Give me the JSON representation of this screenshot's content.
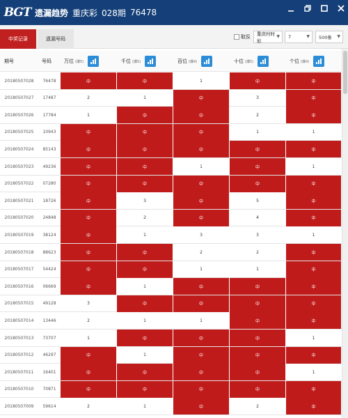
{
  "titlebar": {
    "logo": "BGT",
    "app_name": "遗漏趋势",
    "lottery": "重庆彩",
    "issue": "028期",
    "draw": "76478"
  },
  "tabs": [
    {
      "label": "中奖记录",
      "active": true
    },
    {
      "label": "遗漏号码",
      "active": false
    }
  ],
  "toolbar": {
    "reverse_label": "取反",
    "select_1": "重庆时时彩",
    "select_2": "7",
    "select_3": "500条"
  },
  "columns": {
    "period": "期号",
    "number": "号码",
    "positions": [
      {
        "label": "万位",
        "sub": "(爆5)"
      },
      {
        "label": "千位",
        "sub": "(爆5)"
      },
      {
        "label": "百位",
        "sub": "(爆4)"
      },
      {
        "label": "十位",
        "sub": "(爆5)"
      },
      {
        "label": "个位",
        "sub": "(爆4)"
      }
    ]
  },
  "rows": [
    {
      "period": "20180507028",
      "number": "76478",
      "cells": [
        "中",
        "中",
        "1",
        "中",
        "中"
      ]
    },
    {
      "period": "20180507027",
      "number": "17487",
      "cells": [
        "2",
        "1",
        "中",
        "3",
        "中"
      ]
    },
    {
      "period": "20180507026",
      "number": "17784",
      "cells": [
        "1",
        "中",
        "中",
        "2",
        "中"
      ]
    },
    {
      "period": "20180507025",
      "number": "10943",
      "cells": [
        "中",
        "中",
        "中",
        "1",
        "1"
      ]
    },
    {
      "period": "20180507024",
      "number": "85143",
      "cells": [
        "中",
        "中",
        "中",
        "中",
        "中"
      ]
    },
    {
      "period": "20180507023",
      "number": "49236",
      "cells": [
        "中",
        "中",
        "1",
        "中",
        "1"
      ]
    },
    {
      "period": "20180507022",
      "number": "07280",
      "cells": [
        "中",
        "中",
        "中",
        "中",
        "中"
      ]
    },
    {
      "period": "20180507021",
      "number": "18726",
      "cells": [
        "中",
        "3",
        "中",
        "5",
        "中"
      ]
    },
    {
      "period": "20180507020",
      "number": "24848",
      "cells": [
        "中",
        "2",
        "中",
        "4",
        "中"
      ]
    },
    {
      "period": "20180507019",
      "number": "38124",
      "cells": [
        "中",
        "1",
        "3",
        "3",
        "1"
      ]
    },
    {
      "period": "20180507018",
      "number": "88623",
      "cells": [
        "中",
        "中",
        "2",
        "2",
        "中"
      ]
    },
    {
      "period": "20180507017",
      "number": "54424",
      "cells": [
        "中",
        "中",
        "1",
        "1",
        "中"
      ]
    },
    {
      "period": "20180507016",
      "number": "06669",
      "cells": [
        "中",
        "1",
        "中",
        "中",
        "中"
      ]
    },
    {
      "period": "20180507015",
      "number": "49128",
      "cells": [
        "3",
        "中",
        "中",
        "中",
        "中"
      ]
    },
    {
      "period": "20180507014",
      "number": "13446",
      "cells": [
        "2",
        "1",
        "1",
        "中",
        "中"
      ]
    },
    {
      "period": "20180507013",
      "number": "73707",
      "cells": [
        "1",
        "中",
        "中",
        "中",
        "1"
      ]
    },
    {
      "period": "20180507012",
      "number": "46297",
      "cells": [
        "中",
        "1",
        "中",
        "中",
        "中"
      ]
    },
    {
      "period": "20180507011",
      "number": "16401",
      "cells": [
        "中",
        "中",
        "中",
        "中",
        "1"
      ]
    },
    {
      "period": "20180507010",
      "number": "70871",
      "cells": [
        "中",
        "中",
        "中",
        "中",
        "中"
      ]
    },
    {
      "period": "20180507009",
      "number": "59614",
      "cells": [
        "2",
        "1",
        "中",
        "2",
        "中"
      ]
    }
  ],
  "colors": {
    "titlebar": "#143f78",
    "hit": "#c01b1b",
    "tab_active": "#c0201f",
    "chart_button": "#2b8cd8"
  },
  "icons": [
    "chart-icon",
    "minimize-icon",
    "restore-icon",
    "maximize-icon",
    "close-icon",
    "chevron-down-icon"
  ]
}
